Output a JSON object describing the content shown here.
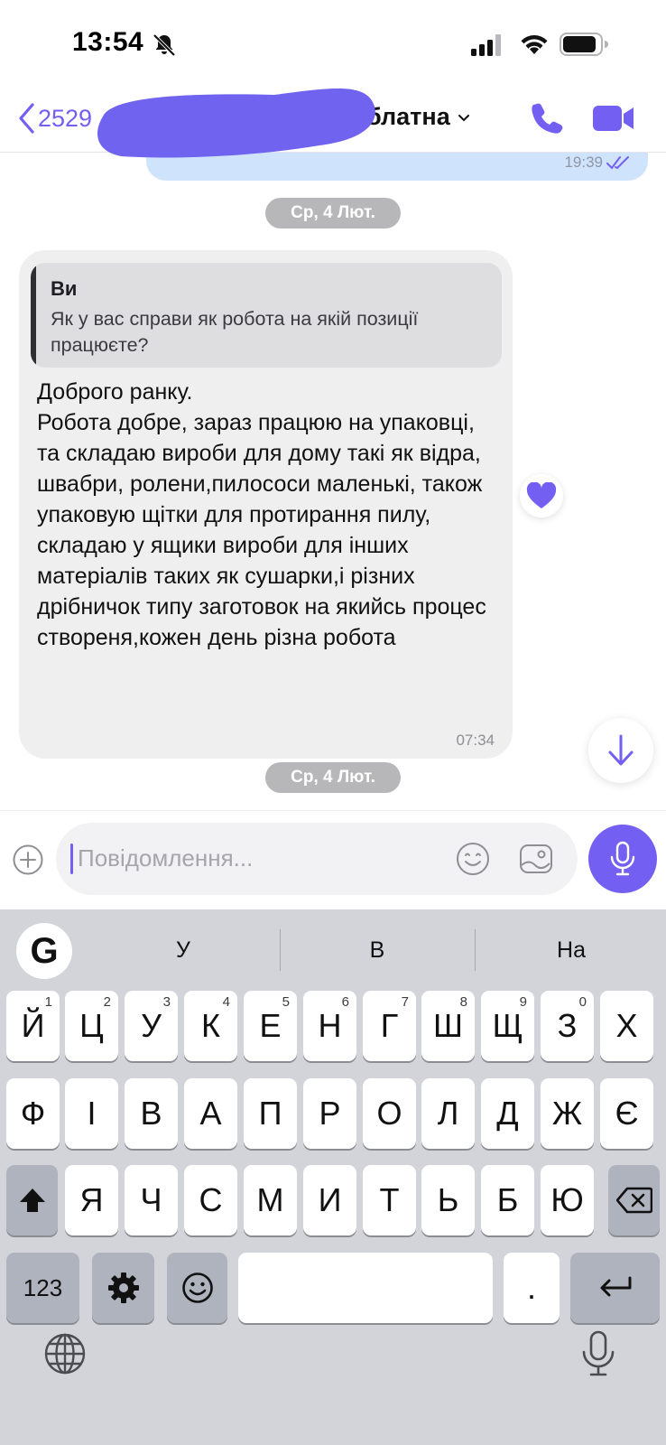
{
  "status_bar": {
    "time": "13:54",
    "icons": [
      "bell-slash-icon",
      "cellular-signal-icon",
      "wifi-icon",
      "battery-icon"
    ]
  },
  "header": {
    "back_label": "2529",
    "contact_name": "блатна",
    "icons": [
      "chevron-left-icon",
      "chevron-down-icon",
      "phone-icon",
      "video-camera-icon"
    ],
    "redacted": true
  },
  "messages": {
    "outgoing_partial": {
      "time": "19:39",
      "status": "read"
    },
    "date_separator_1": "Ср, 4 Лют.",
    "incoming": {
      "reply_to_author": "Ви",
      "reply_to_text": "Як у вас справи як робота на якій позиції працюєте?",
      "text": "Доброго ранку.\nРобота добре, зараз працюю на упаковці, та складаю вироби для дому такі як відра, швабри, ролени,пилососи маленькі, також упаковую щітки для протирання пилу, складаю у ящики вироби для інших матеріалів таких як сушарки,і різних дрібничок типу заготовок на якийсь процес створеня,кожен день різна робота",
      "time": "07:34",
      "reaction": "purple-heart-icon"
    },
    "date_separator_2": "Ср, 4 Лют."
  },
  "composer": {
    "placeholder": "Повідомлення...",
    "icons": [
      "plus-circle-icon",
      "emoji-icon",
      "sticker-icon",
      "microphone-icon"
    ]
  },
  "keyboard": {
    "suggestions": [
      "У",
      "В",
      "На"
    ],
    "row1": [
      "Й",
      "Ц",
      "У",
      "К",
      "Е",
      "Н",
      "Г",
      "Ш",
      "Щ",
      "З",
      "Х"
    ],
    "row1_hints": [
      "1",
      "2",
      "3",
      "4",
      "5",
      "6",
      "7",
      "8",
      "9",
      "0",
      ""
    ],
    "row2": [
      "Ф",
      "І",
      "В",
      "А",
      "П",
      "Р",
      "О",
      "Л",
      "Д",
      "Ж",
      "Є"
    ],
    "row3": [
      "Я",
      "Ч",
      "С",
      "М",
      "И",
      "Т",
      "Ь",
      "Б",
      "Ю"
    ],
    "numbers_key": "123",
    "period_key": "."
  },
  "colors": {
    "accent": "#7360f2",
    "outgoing_bubble": "#cfe3fc",
    "incoming_bubble": "#efeff0",
    "keyboard_bg": "#d2d4da"
  }
}
